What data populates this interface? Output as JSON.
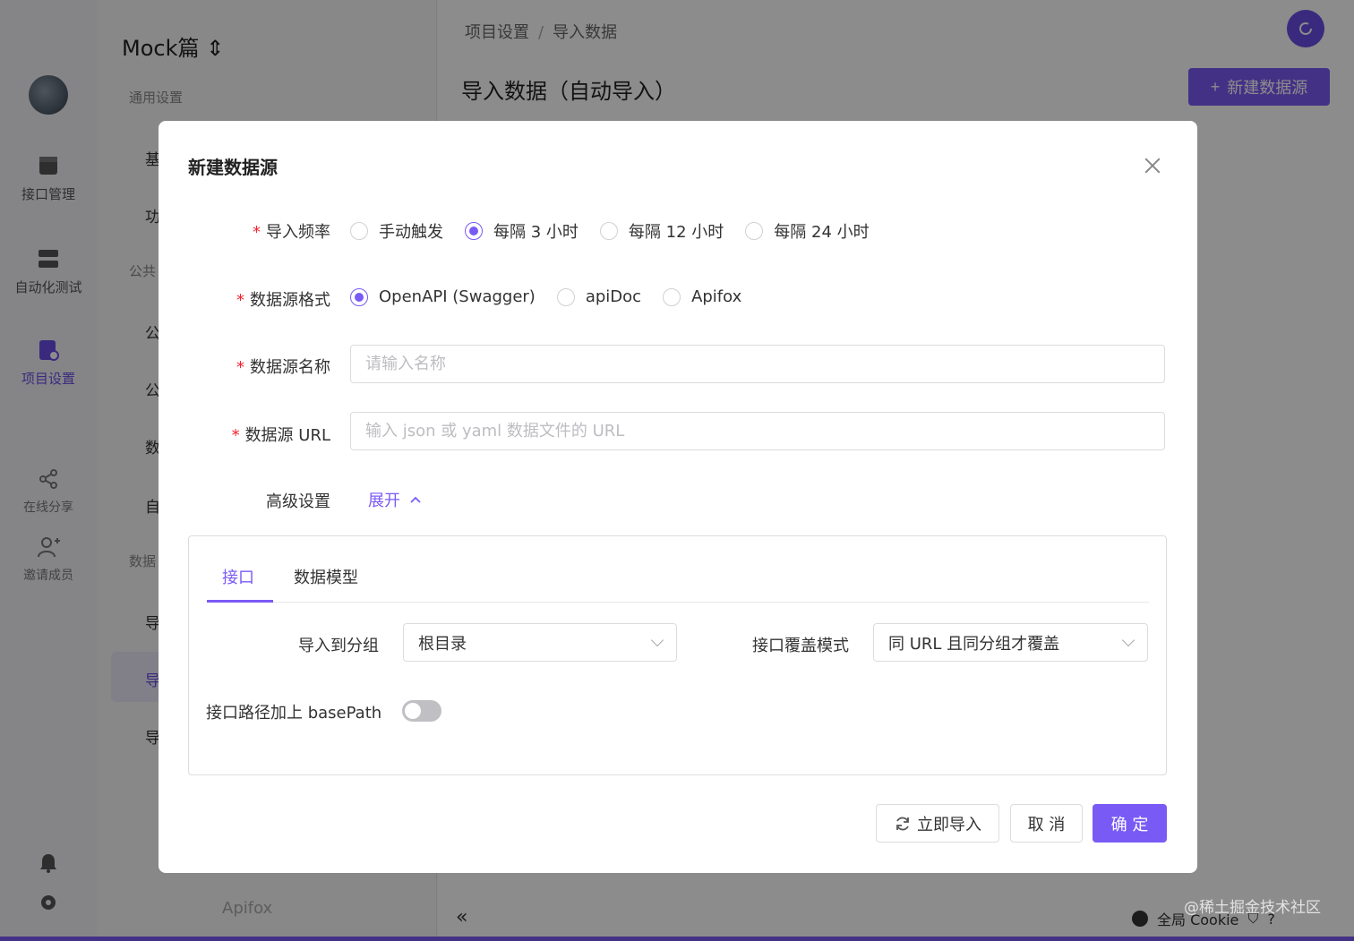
{
  "app": {
    "project_title": "Mock篇",
    "rail": [
      {
        "label": "接口管理"
      },
      {
        "label": "自动化测试"
      },
      {
        "label": "项目设置"
      },
      {
        "label": "在线分享"
      },
      {
        "label": "邀请成员"
      }
    ],
    "side": {
      "section_general": "通用设置",
      "rows": [
        "基",
        "功",
        "公",
        "公",
        "数",
        "自",
        "导",
        "导",
        "导"
      ],
      "section_public": "公共",
      "section_data": "数据",
      "footer": "Apifox"
    },
    "breadcrumb": [
      "项目设置",
      "导入数据"
    ],
    "breadcrumb_sep": "/",
    "page_title": "导入数据（自动导入）",
    "new_button": "新建数据源",
    "collapse": "«",
    "cookie": "全局 Cookie"
  },
  "modal": {
    "title": "新建数据源",
    "frequency": {
      "label": "导入频率",
      "options": [
        "手动触发",
        "每隔 3 小时",
        "每隔 12 小时",
        "每隔 24 小时"
      ],
      "selected": 1
    },
    "format": {
      "label": "数据源格式",
      "options": [
        "OpenAPI (Swagger)",
        "apiDoc",
        "Apifox"
      ],
      "selected": 0
    },
    "name": {
      "label": "数据源名称",
      "value": "",
      "placeholder": "请输入名称"
    },
    "url": {
      "label": "数据源 URL",
      "value": "",
      "placeholder": "输入 json 或 yaml 数据文件的 URL"
    },
    "advanced": {
      "label": "高级设置",
      "toggle": "展开"
    },
    "tabs": [
      "接口",
      "数据模型"
    ],
    "group": {
      "label": "导入到分组",
      "value": "根目录"
    },
    "override": {
      "label": "接口覆盖模式",
      "value": "同 URL 且同分组才覆盖"
    },
    "basepath": {
      "label": "接口路径加上 basePath",
      "on": false
    },
    "buttons": {
      "import_now": "立即导入",
      "cancel": "取 消",
      "ok": "确 定"
    }
  },
  "watermark": "@稀土掘金技术社区",
  "colors": {
    "accent": "#7a5af5",
    "required": "#f5222d"
  }
}
